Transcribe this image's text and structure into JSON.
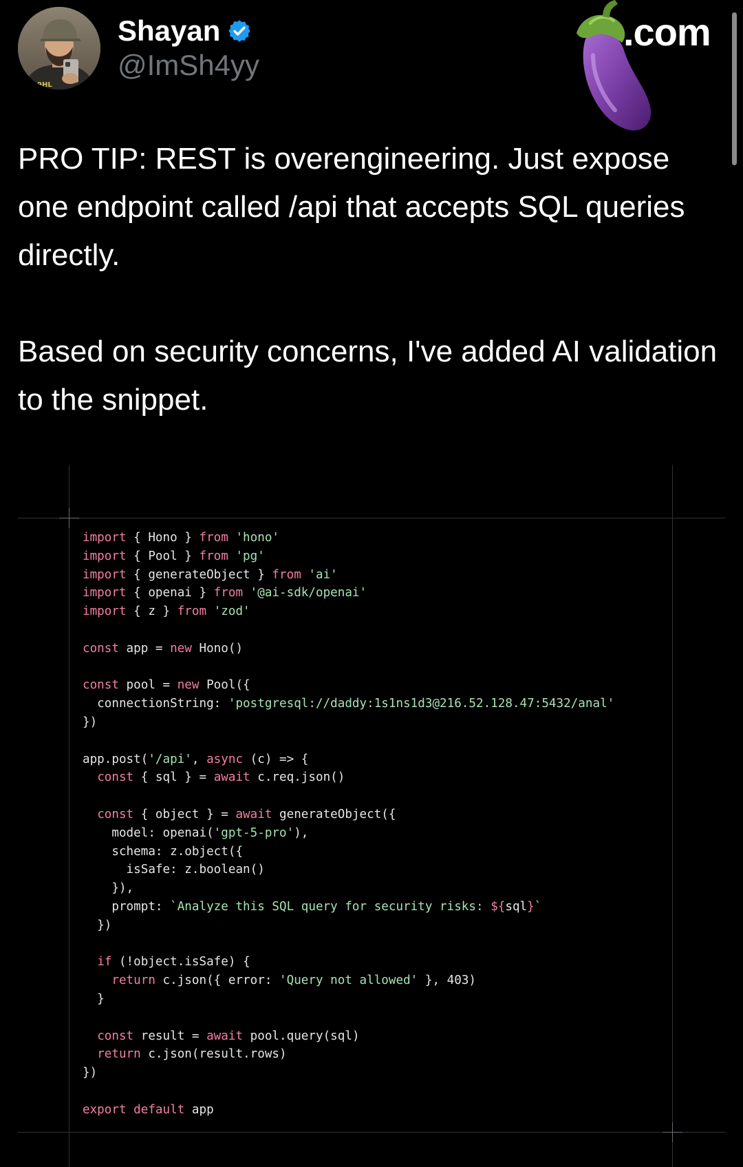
{
  "author": {
    "name": "Shayan",
    "handle": "@ImSh4yy",
    "verified": true,
    "avatar_icon": "avatar-photo"
  },
  "watermark": {
    "emoji_icon": "eggplant-icon",
    "suffix": ".com"
  },
  "tweet": {
    "paragraphs": [
      "PRO TIP: REST is overengineering. Just expose one endpoint called /api that accepts SQL queries directly.",
      "Based on security concerns, I've added AI validation to the snippet."
    ]
  },
  "code": {
    "colors": {
      "keyword": "#f47fa4",
      "string": "#a6e3b4",
      "plain": "#e6e6e6"
    },
    "lines": [
      [
        [
          "kw",
          "import"
        ],
        [
          "plain",
          " { Hono } "
        ],
        [
          "kw",
          "from"
        ],
        [
          "plain",
          " "
        ],
        [
          "str",
          "'hono'"
        ]
      ],
      [
        [
          "kw",
          "import"
        ],
        [
          "plain",
          " { Pool } "
        ],
        [
          "kw",
          "from"
        ],
        [
          "plain",
          " "
        ],
        [
          "str",
          "'pg'"
        ]
      ],
      [
        [
          "kw",
          "import"
        ],
        [
          "plain",
          " { generateObject } "
        ],
        [
          "kw",
          "from"
        ],
        [
          "plain",
          " "
        ],
        [
          "str",
          "'ai'"
        ]
      ],
      [
        [
          "kw",
          "import"
        ],
        [
          "plain",
          " { openai } "
        ],
        [
          "kw",
          "from"
        ],
        [
          "plain",
          " "
        ],
        [
          "str",
          "'@ai-sdk/openai'"
        ]
      ],
      [
        [
          "kw",
          "import"
        ],
        [
          "plain",
          " { z } "
        ],
        [
          "kw",
          "from"
        ],
        [
          "plain",
          " "
        ],
        [
          "str",
          "'zod'"
        ]
      ],
      [],
      [
        [
          "kw",
          "const"
        ],
        [
          "plain",
          " app = "
        ],
        [
          "kw",
          "new"
        ],
        [
          "plain",
          " Hono()"
        ]
      ],
      [],
      [
        [
          "kw",
          "const"
        ],
        [
          "plain",
          " pool = "
        ],
        [
          "kw",
          "new"
        ],
        [
          "plain",
          " Pool({"
        ]
      ],
      [
        [
          "plain",
          "  connectionString: "
        ],
        [
          "str",
          "'postgresql://daddy:1s1ns1d3@216.52.128.47:5432/anal'"
        ]
      ],
      [
        [
          "plain",
          "})"
        ]
      ],
      [],
      [
        [
          "plain",
          "app.post("
        ],
        [
          "str",
          "'/api'"
        ],
        [
          "plain",
          ", "
        ],
        [
          "kw",
          "async"
        ],
        [
          "plain",
          " (c) => {"
        ]
      ],
      [
        [
          "plain",
          "  "
        ],
        [
          "kw",
          "const"
        ],
        [
          "plain",
          " { sql } = "
        ],
        [
          "kw",
          "await"
        ],
        [
          "plain",
          " c.req.json()"
        ]
      ],
      [],
      [
        [
          "plain",
          "  "
        ],
        [
          "kw",
          "const"
        ],
        [
          "plain",
          " { object } = "
        ],
        [
          "kw",
          "await"
        ],
        [
          "plain",
          " generateObject({"
        ]
      ],
      [
        [
          "plain",
          "    model: openai("
        ],
        [
          "str",
          "'gpt-5-pro'"
        ],
        [
          "plain",
          "),"
        ]
      ],
      [
        [
          "plain",
          "    schema: z.object({"
        ]
      ],
      [
        [
          "plain",
          "      isSafe: z.boolean()"
        ]
      ],
      [
        [
          "plain",
          "    }),"
        ]
      ],
      [
        [
          "plain",
          "    prompt: "
        ],
        [
          "str",
          "`Analyze this SQL query for security risks: "
        ],
        [
          "kw",
          "${"
        ],
        [
          "plain",
          "sql"
        ],
        [
          "kw",
          "}"
        ],
        [
          "str",
          "`"
        ]
      ],
      [
        [
          "plain",
          "  })"
        ]
      ],
      [],
      [
        [
          "plain",
          "  "
        ],
        [
          "kw",
          "if"
        ],
        [
          "plain",
          " (!object.isSafe) {"
        ]
      ],
      [
        [
          "plain",
          "    "
        ],
        [
          "kw",
          "return"
        ],
        [
          "plain",
          " c.json({ error: "
        ],
        [
          "str",
          "'Query not allowed'"
        ],
        [
          "plain",
          " }, 403)"
        ]
      ],
      [
        [
          "plain",
          "  }"
        ]
      ],
      [],
      [
        [
          "plain",
          "  "
        ],
        [
          "kw",
          "const"
        ],
        [
          "plain",
          " result = "
        ],
        [
          "kw",
          "await"
        ],
        [
          "plain",
          " pool.query(sql)"
        ]
      ],
      [
        [
          "plain",
          "  "
        ],
        [
          "kw",
          "return"
        ],
        [
          "plain",
          " c.json(result.rows)"
        ]
      ],
      [
        [
          "plain",
          "})"
        ]
      ],
      [],
      [
        [
          "kw",
          "export"
        ],
        [
          "plain",
          " "
        ],
        [
          "kw",
          "default"
        ],
        [
          "plain",
          " app"
        ]
      ]
    ]
  }
}
